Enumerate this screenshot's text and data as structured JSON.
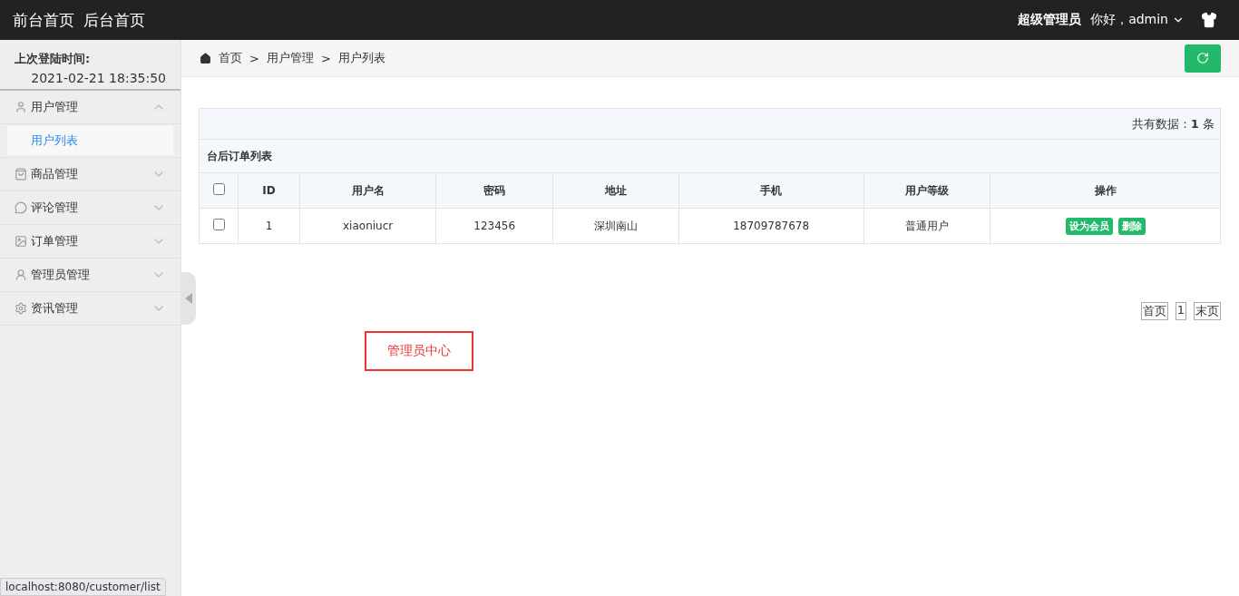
{
  "header": {
    "links": [
      "前台首页",
      "后台首页"
    ],
    "role": "超级管理员",
    "greeting": "你好，admin"
  },
  "sidebar": {
    "last_login_label": "上次登陆时间:",
    "last_login_time": "2021-02-21 18:35:50",
    "menu": [
      {
        "label": "用户管理",
        "expanded": true,
        "children": [
          {
            "label": "用户列表",
            "selected": true
          }
        ]
      },
      {
        "label": "商品管理",
        "expanded": false
      },
      {
        "label": "评论管理",
        "expanded": false
      },
      {
        "label": "订单管理",
        "expanded": false
      },
      {
        "label": "管理员管理",
        "expanded": false
      },
      {
        "label": "资讯管理",
        "expanded": false
      }
    ]
  },
  "breadcrumb": {
    "items": [
      "首页",
      "用户管理",
      "用户列表"
    ],
    "separator": ">"
  },
  "table": {
    "total": "共有数据：**1** 条",
    "title": "台后订单列表",
    "header_checked": false,
    "columns": [
      "ID",
      "用户名",
      "密码",
      "地址",
      "手机",
      "用户等级",
      "操作"
    ],
    "rows": [
      {
        "checked": false,
        "cells": [
          "1",
          "xiaoniucr",
          "123456",
          "深圳南山",
          "18709787678",
          "普通用户"
        ],
        "actions": [
          "设为会员",
          "删除"
        ]
      }
    ]
  },
  "pagination": [
    "首页",
    "1",
    "末页"
  ],
  "admin_center": "管理员中心",
  "status_url": "localhost:8080/customer/list"
}
